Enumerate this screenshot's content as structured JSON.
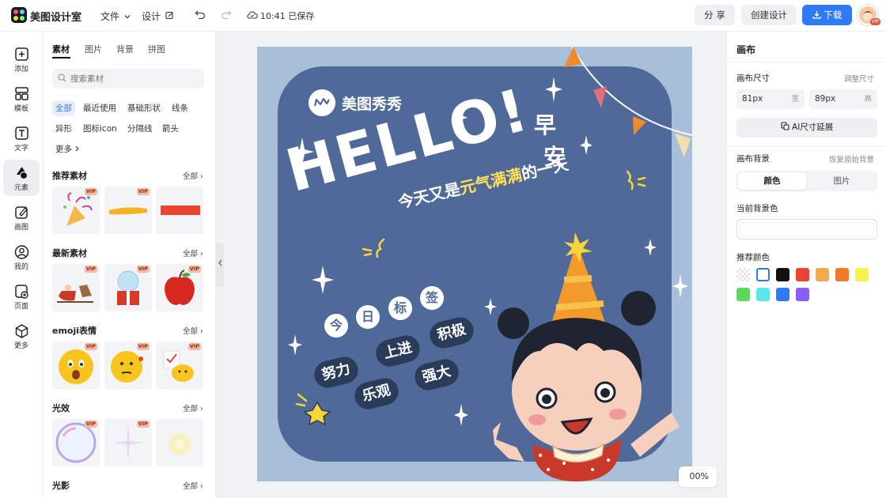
{
  "app": {
    "title": "美图设计室"
  },
  "topbar": {
    "file_menu": "文件",
    "design_menu": "设计",
    "save_status": "10:41 已保存",
    "share_label": "分 享",
    "create_label": "创建设计",
    "download_label": "下载",
    "avatar_badge": "VIP"
  },
  "rail": [
    {
      "label": "添加",
      "icon": "plus-square-icon"
    },
    {
      "label": "模板",
      "icon": "template-icon"
    },
    {
      "label": "文字",
      "icon": "text-icon"
    },
    {
      "label": "元素",
      "icon": "shapes-icon",
      "active": true
    },
    {
      "label": "画图",
      "icon": "pen-icon"
    },
    {
      "label": "我的",
      "icon": "user-icon"
    },
    {
      "label": "页面",
      "icon": "page-icon"
    },
    {
      "label": "更多",
      "icon": "cube-icon"
    }
  ],
  "panel": {
    "tabs": [
      "素材",
      "图片",
      "背景",
      "拼图"
    ],
    "search_placeholder": "搜索素材",
    "chips": [
      "全部",
      "最近使用",
      "基础形状",
      "线条",
      "异形",
      "图标icon",
      "分隔线",
      "箭头",
      "更多"
    ],
    "vip_badge": "VIP",
    "sections": [
      {
        "title": "推荐素材",
        "all": "全部"
      },
      {
        "title": "最新素材",
        "all": "全部"
      },
      {
        "title": "emoji表情",
        "all": "全部"
      },
      {
        "title": "光效",
        "all": "全部"
      },
      {
        "title": "光影",
        "all": "全部"
      }
    ]
  },
  "canvas": {
    "brand": "美图秀秀",
    "hello": "HELLO!",
    "morning_1": "早",
    "morning_2": "安",
    "slogan_pre": "今天又是",
    "slogan_hl": "元气满满",
    "slogan_post": "的一天",
    "tag_letters": [
      "今",
      "日",
      "标",
      "签"
    ],
    "pills": [
      "努力",
      "上进",
      "积极",
      "乐观",
      "强大"
    ],
    "zoom": "00%",
    "colors": {
      "background": "#a9bfd9",
      "card": "#4f6a98",
      "highlight": "#ffe25a",
      "pill": "#2b3c5b"
    }
  },
  "right": {
    "title": "画布",
    "size_label": "画布尺寸",
    "adjust_size": "调整尺寸",
    "width_value": "81px",
    "width_unit": "宽",
    "height_value": "89px",
    "height_unit": "高",
    "ai_expand": "AI尺寸延展",
    "bg_label": "画布背景",
    "restore_bg": "恢复原始背景",
    "bg_tab_color": "颜色",
    "bg_tab_image": "图片",
    "current_bg_label": "当前背景色",
    "recommended_label": "推荐颜色",
    "swatches": [
      "transparent",
      "#ffffff",
      "#111111",
      "#e8442f",
      "#f4a94b",
      "#ef7a2c",
      "#f6f44a",
      "#5bd75a",
      "#5ce6e6",
      "#2f7bf5",
      "#8b5cf6"
    ]
  },
  "accent": "#2f7bf5"
}
